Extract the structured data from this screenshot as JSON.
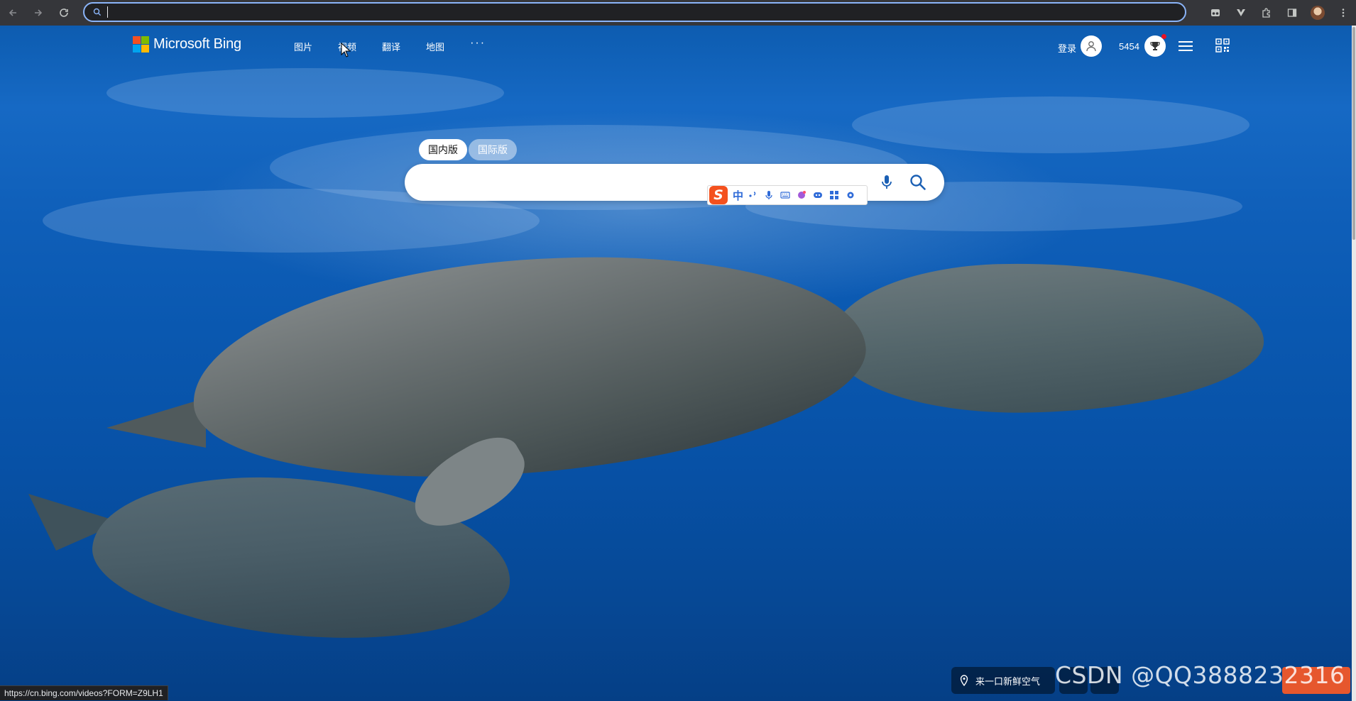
{
  "browser": {
    "omnibox_value": "",
    "status_url": "https://cn.bing.com/videos?FORM=Z9LH1"
  },
  "header": {
    "logo_text": "Microsoft Bing",
    "nav": [
      {
        "label": "图片"
      },
      {
        "label": "视频"
      },
      {
        "label": "翻译"
      },
      {
        "label": "地图"
      }
    ],
    "more_label": "···",
    "login_label": "登录",
    "points": "5454"
  },
  "search": {
    "tabs": [
      {
        "label": "国内版",
        "active": true
      },
      {
        "label": "国际版",
        "active": false
      }
    ],
    "value": ""
  },
  "ime": {
    "mode_label": "中"
  },
  "footer": {
    "location_label": "来一口新鲜空气",
    "watermark": "CSDN @QQ3888232316"
  },
  "colors": {
    "ms_red": "#f25022",
    "ms_green": "#7fba00",
    "ms_blue": "#00a4ef",
    "ms_yellow": "#ffb900",
    "omnibox_focus": "#8ab4f8",
    "ime_orange": "#f4511e"
  }
}
